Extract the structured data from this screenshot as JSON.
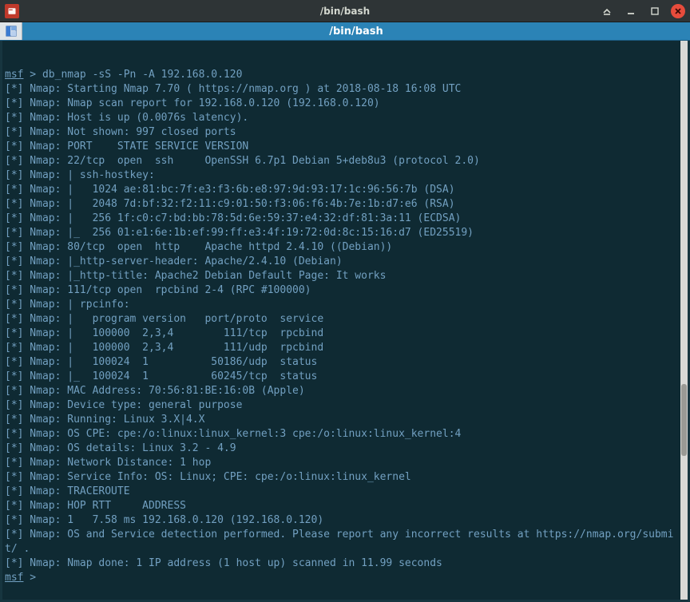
{
  "window": {
    "title": "/bin/bash"
  },
  "tab": {
    "label": "/bin/bash"
  },
  "prompt": {
    "msf": "msf",
    "gt": " > ",
    "command": "db_nmap -sS -Pn -A 192.168.0.120"
  },
  "output": [
    "[*] Nmap: Starting Nmap 7.70 ( https://nmap.org ) at 2018-08-18 16:08 UTC",
    "[*] Nmap: Nmap scan report for 192.168.0.120 (192.168.0.120)",
    "[*] Nmap: Host is up (0.0076s latency).",
    "[*] Nmap: Not shown: 997 closed ports",
    "[*] Nmap: PORT    STATE SERVICE VERSION",
    "[*] Nmap: 22/tcp  open  ssh     OpenSSH 6.7p1 Debian 5+deb8u3 (protocol 2.0)",
    "[*] Nmap: | ssh-hostkey:",
    "[*] Nmap: |   1024 ae:81:bc:7f:e3:f3:6b:e8:97:9d:93:17:1c:96:56:7b (DSA)",
    "[*] Nmap: |   2048 7d:bf:32:f2:11:c9:01:50:f3:06:f6:4b:7e:1b:d7:e6 (RSA)",
    "[*] Nmap: |   256 1f:c0:c7:bd:bb:78:5d:6e:59:37:e4:32:df:81:3a:11 (ECDSA)",
    "[*] Nmap: |_  256 01:e1:6e:1b:ef:99:ff:e3:4f:19:72:0d:8c:15:16:d7 (ED25519)",
    "[*] Nmap: 80/tcp  open  http    Apache httpd 2.4.10 ((Debian))",
    "[*] Nmap: |_http-server-header: Apache/2.4.10 (Debian)",
    "[*] Nmap: |_http-title: Apache2 Debian Default Page: It works",
    "[*] Nmap: 111/tcp open  rpcbind 2-4 (RPC #100000)",
    "[*] Nmap: | rpcinfo:",
    "[*] Nmap: |   program version   port/proto  service",
    "[*] Nmap: |   100000  2,3,4        111/tcp  rpcbind",
    "[*] Nmap: |   100000  2,3,4        111/udp  rpcbind",
    "[*] Nmap: |   100024  1          50186/udp  status",
    "[*] Nmap: |_  100024  1          60245/tcp  status",
    "[*] Nmap: MAC Address: 70:56:81:BE:16:0B (Apple)",
    "[*] Nmap: Device type: general purpose",
    "[*] Nmap: Running: Linux 3.X|4.X",
    "[*] Nmap: OS CPE: cpe:/o:linux:linux_kernel:3 cpe:/o:linux:linux_kernel:4",
    "[*] Nmap: OS details: Linux 3.2 - 4.9",
    "[*] Nmap: Network Distance: 1 hop",
    "[*] Nmap: Service Info: OS: Linux; CPE: cpe:/o:linux:linux_kernel",
    "[*] Nmap: TRACEROUTE",
    "[*] Nmap: HOP RTT     ADDRESS",
    "[*] Nmap: 1   7.58 ms 192.168.0.120 (192.168.0.120)",
    "[*] Nmap: OS and Service detection performed. Please report any incorrect results at https://nmap.org/submit/ .",
    "[*] Nmap: Nmap done: 1 IP address (1 host up) scanned in 11.99 seconds"
  ],
  "prompt2": {
    "msf": "msf",
    "gt": " > "
  }
}
